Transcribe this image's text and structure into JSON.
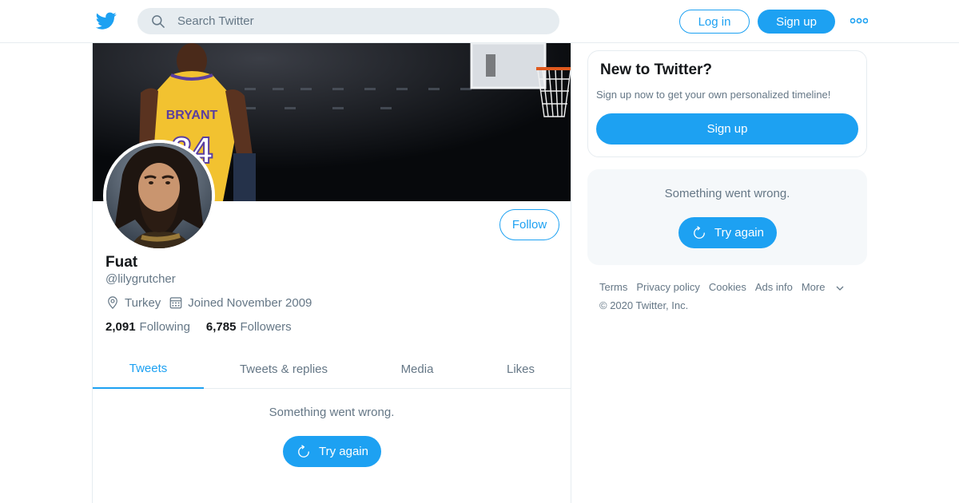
{
  "header": {
    "search_placeholder": "Search Twitter",
    "login_label": "Log in",
    "signup_label": "Sign up"
  },
  "profile": {
    "name": "Fuat",
    "handle": "@lilygrutcher",
    "location": "Turkey",
    "joined": "Joined November 2009",
    "following_count": "2,091",
    "following_label": "Following",
    "followers_count": "6,785",
    "followers_label": "Followers",
    "follow_label": "Follow",
    "banner_jersey_text": "BRYANT",
    "banner_jersey_number": "24"
  },
  "tabs": [
    {
      "label": "Tweets",
      "active": true
    },
    {
      "label": "Tweets & replies",
      "active": false
    },
    {
      "label": "Media",
      "active": false
    },
    {
      "label": "Likes",
      "active": false
    }
  ],
  "timeline": {
    "error_text": "Something went wrong.",
    "retry_label": "Try again"
  },
  "sidebar": {
    "signup_card": {
      "title": "New to Twitter?",
      "subtitle": "Sign up now to get your own personalized timeline!",
      "button_label": "Sign up"
    },
    "trends_error": {
      "error_text": "Something went wrong.",
      "retry_label": "Try again"
    },
    "footer": {
      "links": [
        "Terms",
        "Privacy policy",
        "Cookies",
        "Ads info",
        "More"
      ],
      "copyright": "© 2020 Twitter, Inc."
    }
  },
  "colors": {
    "accent": "#1da1f2",
    "text_primary": "#14171a",
    "text_secondary": "#657786",
    "border": "#e6ecf0",
    "card_bg": "#f5f8fa"
  },
  "icons": [
    "twitter-bird-icon",
    "search-icon",
    "more-dots-icon",
    "location-pin-icon",
    "calendar-icon",
    "refresh-icon",
    "chevron-down-icon"
  ]
}
